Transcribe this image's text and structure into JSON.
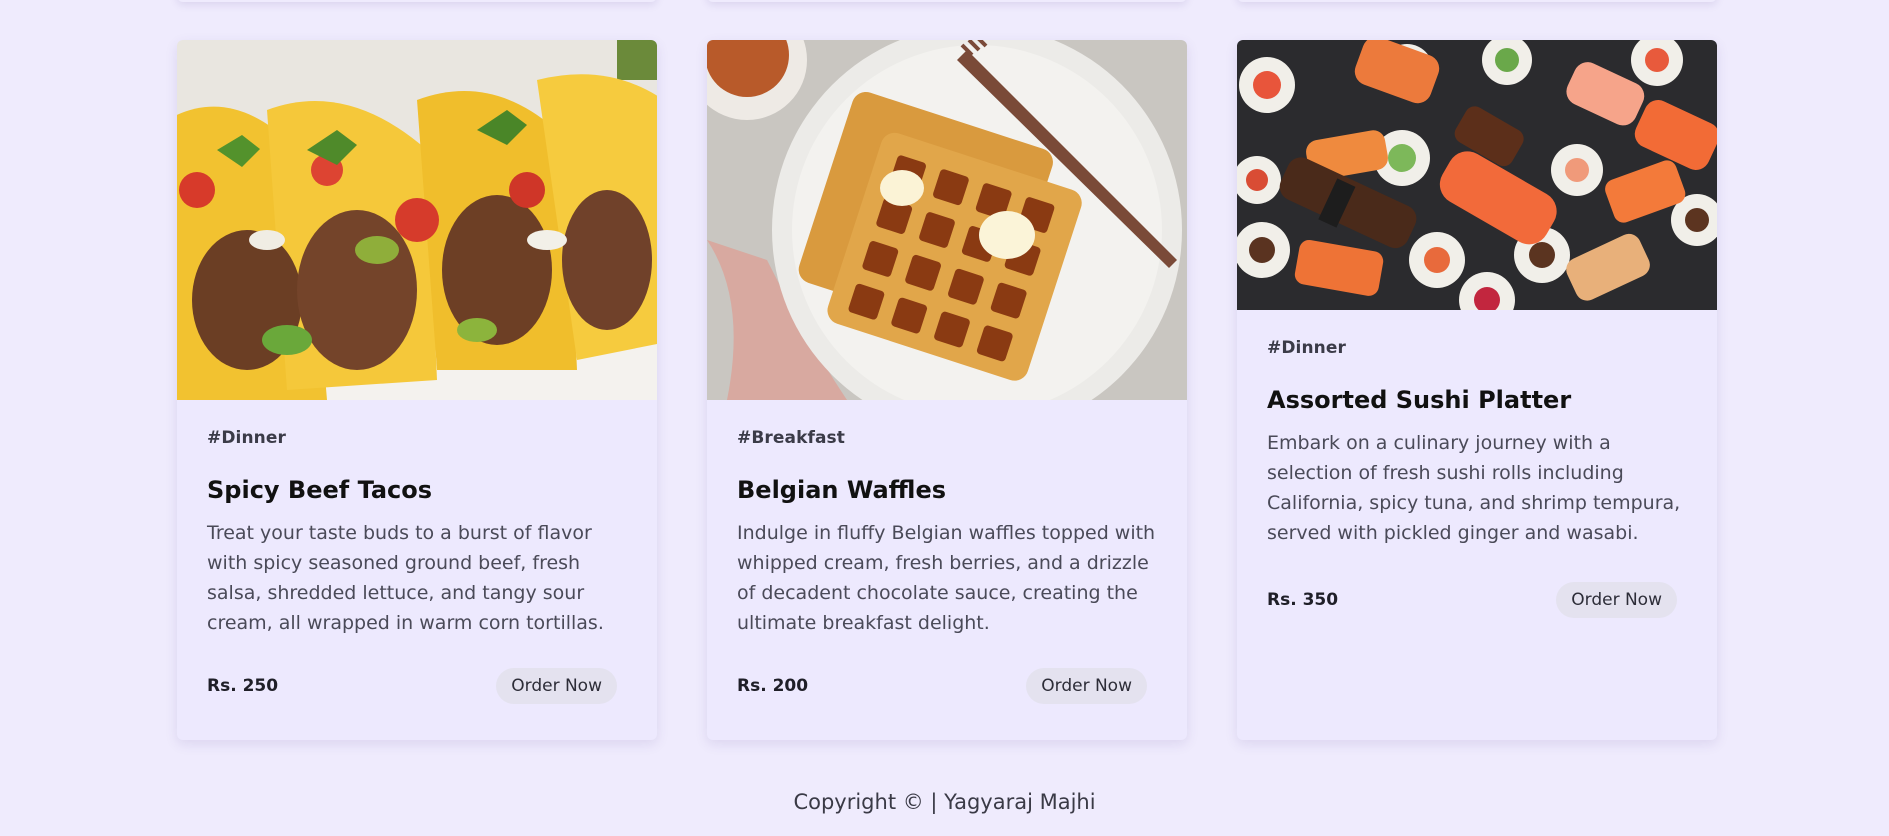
{
  "cards": [
    {
      "image": "spicy-beef-tacos-photo",
      "tag": "#Dinner",
      "title": "Spicy Beef Tacos",
      "description": "Treat your taste buds to a burst of flavor with spicy seasoned ground beef, fresh salsa, shredded lettuce, and tangy sour cream, all wrapped in warm corn tortillas.",
      "price": "Rs. 250",
      "button": "Order Now"
    },
    {
      "image": "belgian-waffles-photo",
      "tag": "#Breakfast",
      "title": "Belgian Waffles",
      "description": "Indulge in fluffy Belgian waffles topped with whipped cream, fresh berries, and a drizzle of decadent chocolate sauce, creating the ultimate breakfast delight.",
      "price": "Rs. 200",
      "button": "Order Now"
    },
    {
      "image": "assorted-sushi-photo",
      "tag": "#Dinner",
      "title": "Assorted Sushi Platter",
      "description": "Embark on a culinary journey with a selection of fresh sushi rolls including California, spicy tuna, and shrimp tempura, served with pickled ginger and wasabi.",
      "price": "Rs. 350",
      "button": "Order Now"
    }
  ],
  "footer": {
    "copyright": "Copyright © | Yagyaraj Majhi"
  },
  "colors": {
    "background": "#efebfd",
    "card": "#ede9fe",
    "button": "#e4e2ef"
  }
}
